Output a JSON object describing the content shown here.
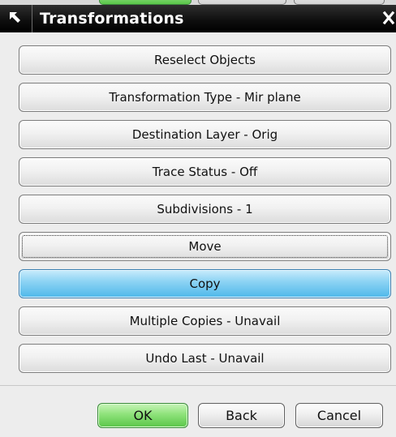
{
  "window": {
    "title": "Transformations"
  },
  "menu_buttons": [
    {
      "label": "Reselect Objects",
      "name": "reselect-objects-button"
    },
    {
      "label": "Transformation Type - Mir plane",
      "name": "transformation-type-button"
    },
    {
      "label": "Destination Layer - Orig",
      "name": "destination-layer-button"
    },
    {
      "label": "Trace Status - Off",
      "name": "trace-status-button"
    },
    {
      "label": "Subdivisions - 1",
      "name": "subdivisions-button"
    },
    {
      "label": "Move",
      "name": "move-button",
      "state": "focused"
    },
    {
      "label": "Copy",
      "name": "copy-button",
      "state": "selected"
    },
    {
      "label": "Multiple Copies - Unavail",
      "name": "multiple-copies-button"
    },
    {
      "label": "Undo Last - Unavail",
      "name": "undo-last-button"
    }
  ],
  "footer": {
    "ok_label": "OK",
    "back_label": "Back",
    "cancel_label": "Cancel"
  },
  "icons": {
    "title_grip": "arrow-grip-icon",
    "close": "close-icon"
  },
  "colors": {
    "titlebar": "#000000",
    "selected_button": "#6ac4ee",
    "ok_button": "#7ed86a"
  }
}
